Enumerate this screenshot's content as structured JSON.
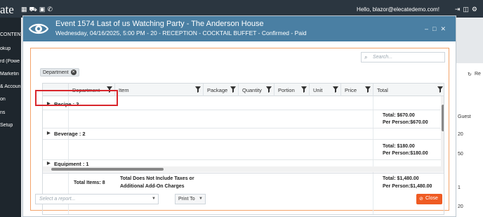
{
  "app": {
    "brand": "ate",
    "hello_text": "Hello, blazor@elecatedemo.com!",
    "sidebar_items": [
      "CONTENT",
      "okup",
      "rd (Powe",
      "Marketin",
      "& Accoun",
      "on",
      "ns",
      "Setup"
    ],
    "right_panel": {
      "refresh_label": "Re",
      "guest_label": "Guest",
      "values": [
        "20",
        "50",
        "1",
        "20"
      ]
    }
  },
  "modal": {
    "title": "Event 1574 Last of us Watching Party - The Anderson House",
    "subtitle": "Wednesday, 04/16/2025, 5:00 PM - 20 - RECEPTION - COCKTAIL BUFFET - Confirmed - Paid",
    "search_placeholder": "Search...",
    "group_chip": "Department",
    "columns": [
      "Department",
      "Item",
      "Package",
      "Quantity",
      "Portion",
      "Unit",
      "Price",
      "Total"
    ],
    "groups": [
      {
        "label": "Recipe : 3",
        "total": "Total: $670.00",
        "per_person": "Per Person:$670.00"
      },
      {
        "label": "Beverage : 2",
        "total": "Total: $180.00",
        "per_person": "Per Person:$180.00"
      },
      {
        "label": "Equipment : 1"
      }
    ],
    "footer": {
      "total_items": "Total Items: 8",
      "note_line1": "Total Does Not Include Taxes or",
      "note_line2": "Additional Add-On Charges",
      "total": "Total: $1,480.00",
      "per_person": "Per Person:$1,480.00"
    },
    "report_placeholder": "Select a report...",
    "print_label": "Print To",
    "close_label": "Close"
  },
  "colors": {
    "header": "#4a7fa3",
    "close": "#ef5b23",
    "highlight": "#d9262c",
    "frame": "#f3a36a"
  }
}
